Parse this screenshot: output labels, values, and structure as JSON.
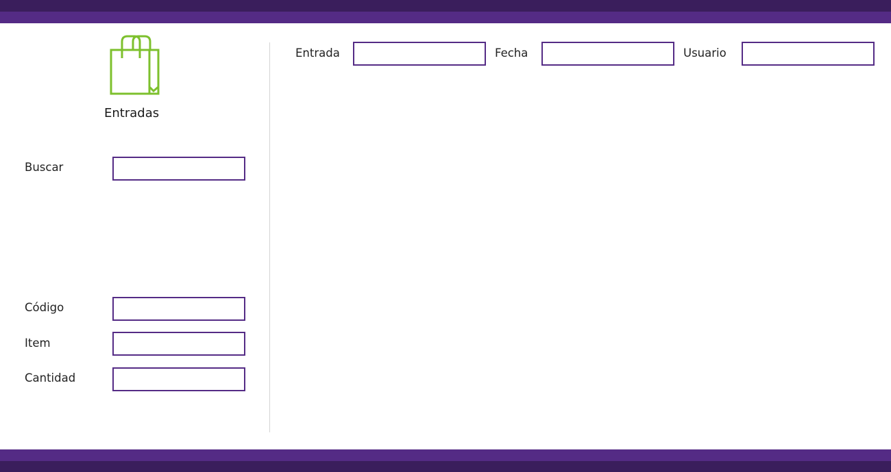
{
  "sidebar": {
    "title": "Entradas",
    "icon": "shopping-bag-icon",
    "search": {
      "label": "Buscar",
      "value": ""
    },
    "form": {
      "codigo": {
        "label": "Código",
        "value": ""
      },
      "item": {
        "label": "Item",
        "value": ""
      },
      "cantidad": {
        "label": "Cantidad",
        "value": ""
      }
    }
  },
  "header": {
    "entrada": {
      "label": "Entrada",
      "value": ""
    },
    "fecha": {
      "label": "Fecha",
      "value": ""
    },
    "usuario": {
      "label": "Usuario",
      "value": ""
    }
  },
  "colors": {
    "accent": "#542b85",
    "accent_dark": "#3a1e5c",
    "icon_green": "#7dc02d",
    "divider": "#d4d4d4"
  }
}
